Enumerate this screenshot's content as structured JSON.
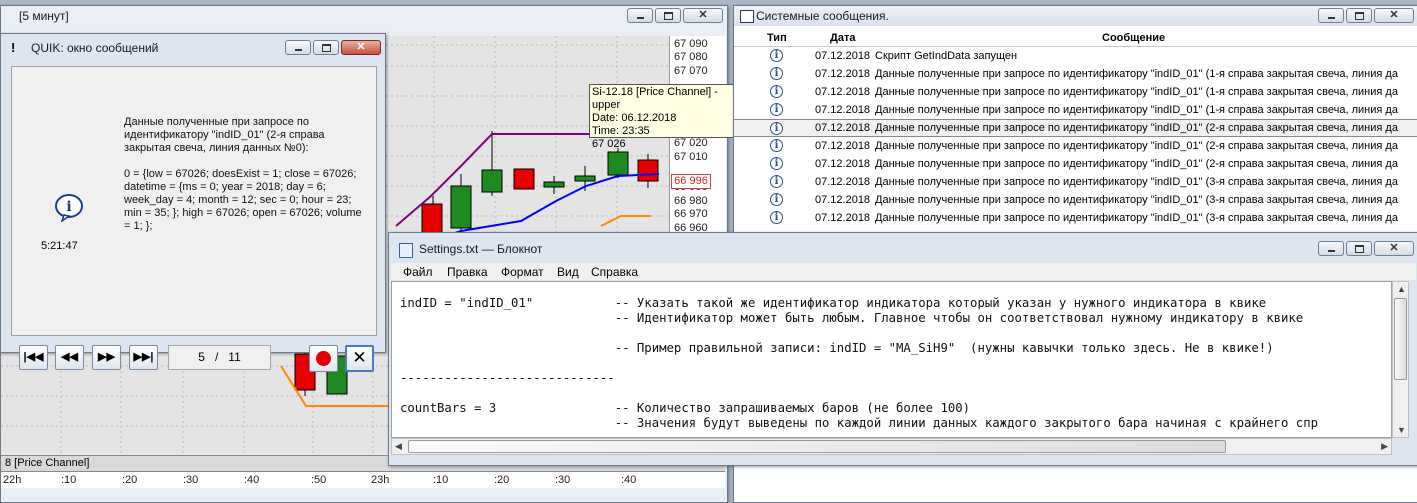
{
  "chart_window": {
    "title": "[5 минут]",
    "price_ticks": [
      "67 090",
      "67 080",
      "67 070",
      "67 020",
      "67 010",
      "66 996",
      "66 990",
      "66 980",
      "66 970",
      "66 960"
    ],
    "current_price": "66 996",
    "tooltip": {
      "line1": "Si-12.18 [Price Channel] - upper",
      "line2": "Date: 06.12.2018",
      "line3": "Time: 23:35",
      "line4": "67 026"
    },
    "bottom_panel_label": "8 [Price Channel]",
    "time_ticks": [
      "22h",
      ":10",
      ":20",
      ":30",
      ":40",
      ":50",
      "23h",
      ":10",
      ":20",
      ":30",
      ":40"
    ]
  },
  "quik_dialog": {
    "title": "QUIK: окно сообщений",
    "message": "Данные полученные при запросе по идентификатору \"indID_01\" (2-я справа закрытая свеча, линия данных №0):\n\n0 = {low = 67026; doesExist = 1; close = 67026; datetime = {ms = 0; year = 2018; day = 6; week_day = 4; month = 12; sec = 0; hour = 23; min = 35; }; high = 67026; open = 67026; volume = 1; };",
    "time": "5:21:47",
    "page_current": "5",
    "page_sep": "/",
    "page_total": "11"
  },
  "system_messages": {
    "title": "Системные сообщения.",
    "columns": {
      "type": "Тип",
      "date": "Дата",
      "message": "Сообщение"
    },
    "rows": [
      {
        "date": "07.12.2018",
        "text": "Скрипт GetIndData запущен"
      },
      {
        "date": "07.12.2018",
        "text": "Данные полученные при запросе по идентификатору \"indID_01\" (1-я справа закрытая свеча, линия да"
      },
      {
        "date": "07.12.2018",
        "text": "Данные полученные при запросе по идентификатору \"indID_01\" (1-я справа закрытая свеча, линия да"
      },
      {
        "date": "07.12.2018",
        "text": "Данные полученные при запросе по идентификатору \"indID_01\" (1-я справа закрытая свеча, линия да"
      },
      {
        "date": "07.12.2018",
        "text": "Данные полученные при запросе по идентификатору \"indID_01\" (2-я справа закрытая свеча, линия да"
      },
      {
        "date": "07.12.2018",
        "text": "Данные полученные при запросе по идентификатору \"indID_01\" (2-я справа закрытая свеча, линия да"
      },
      {
        "date": "07.12.2018",
        "text": "Данные полученные при запросе по идентификатору \"indID_01\" (2-я справа закрытая свеча, линия да"
      },
      {
        "date": "07.12.2018",
        "text": "Данные полученные при запросе по идентификатору \"indID_01\" (3-я справа закрытая свеча, линия да"
      },
      {
        "date": "07.12.2018",
        "text": "Данные полученные при запросе по идентификатору \"indID_01\" (3-я справа закрытая свеча, линия да"
      },
      {
        "date": "07.12.2018",
        "text": "Данные полученные при запросе по идентификатору \"indID_01\" (3-я справа закрытая свеча, линия да"
      }
    ]
  },
  "notepad": {
    "title": "Settings.txt — Блокнот",
    "menu": [
      "Файл",
      "Правка",
      "Формат",
      "Вид",
      "Справка"
    ],
    "content": "indID = \"indID_01\"           -- Указать такой же идентификатор индикатора который указан у нужного индикатора в квике\n                             -- Идентификатор может быть любым. Главное чтобы он соответствовал нужному индикатору в квике\n\n                             -- Пример правильной записи: indID = \"MA_SiH9\"  (нужны кавычки только здесь. Не в квике!)\n\n-----------------------------\n\ncountBars = 3                -- Количество запрашиваемых баров (не более 100)\n                             -- Значения будут выведены по каждой линии данных каждого закрытого бара начиная с крайнего спр"
  }
}
